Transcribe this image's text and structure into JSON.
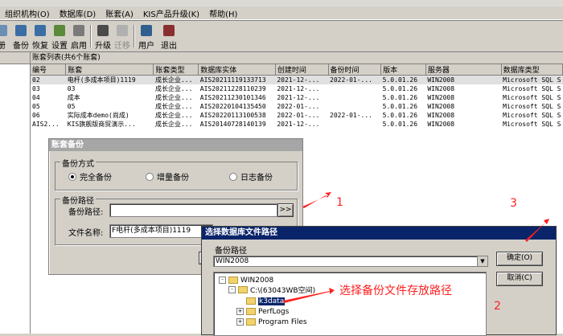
{
  "menu": [
    "组织机构(O)",
    "数据库(D)",
    "账套(A)",
    "KIS产品升级(K)",
    "帮助(H)"
  ],
  "toolbar": [
    {
      "label": "备份",
      "icon": "backup-icon",
      "color": "#3a6ea5"
    },
    {
      "label": "恢复",
      "icon": "restore-icon",
      "color": "#3a6ea5"
    },
    {
      "label": "设置",
      "icon": "settings-icon",
      "color": "#5a8a3a"
    },
    {
      "label": "启用",
      "icon": "enable-icon",
      "color": "#7a7a7a"
    },
    {
      "label": "升级",
      "icon": "upgrade-icon",
      "color": "#4a4a4a"
    },
    {
      "label": "迁移",
      "icon": "migrate-icon",
      "color": "#a0a0a0"
    },
    {
      "label": "用户",
      "icon": "user-icon",
      "color": "#2f5f8f"
    },
    {
      "label": "退出",
      "icon": "exit-icon",
      "color": "#8a2f2f"
    }
  ],
  "toolbar_left_partial": "册",
  "list_title": "账套列表(共6个账套)",
  "columns": [
    "编号",
    "账套",
    "账套类型",
    "数据库实体",
    "创建时间",
    "备份时间",
    "版本",
    "服务器",
    "数据库类型"
  ],
  "rows": [
    [
      "02",
      "电杆(多成本项目)1119",
      "成长企业...",
      "AIS20211119133713",
      "2021-12-...",
      "2022-01-...",
      "5.0.01.26",
      "WIN2008",
      "Microsoft SQL S"
    ],
    [
      "03",
      "03",
      "成长企业...",
      "AIS20211228110239",
      "2021-12-...",
      "",
      "5.0.01.26",
      "WIN2008",
      "Microsoft SQL S"
    ],
    [
      "04",
      "成本",
      "成长企业...",
      "AIS20211230101346",
      "2021-12-...",
      "",
      "5.0.01.26",
      "WIN2008",
      "Microsoft SQL S"
    ],
    [
      "05",
      "05",
      "成长企业...",
      "AIS20220104135450",
      "2022-01-...",
      "",
      "5.0.01.26",
      "WIN2008",
      "Microsoft SQL S"
    ],
    [
      "06",
      "实际成本demo(尚成)",
      "成长企业...",
      "AIS20220113100538",
      "2022-01-...",
      "2022-01-...",
      "5.0.01.26",
      "WIN2008",
      "Microsoft SQL S"
    ],
    [
      "AIS2...",
      "KIS旗舰版商贸演示...",
      "成长企业...",
      "AIS20140728140139",
      "2021-12-...",
      "",
      "5.0.01.26",
      "WIN2008",
      "Microsoft SQL S"
    ]
  ],
  "backup_dialog": {
    "title": "账套备份",
    "mode_group": "备份方式",
    "modes": [
      "完全备份",
      "增量备份",
      "日志备份"
    ],
    "path_group": "备份路径",
    "path_label": "备份路径:",
    "path_value": "",
    "browse_label": ">>",
    "file_label": "文件名称:",
    "file_value": "F电杆(多成本项目)1119"
  },
  "select_dialog": {
    "title": "选择数据库文件路径",
    "group": "备份路径",
    "server": "WIN2008",
    "ok": "确定(O)",
    "cancel": "取消(C)",
    "tree": [
      {
        "label": "WIN2008",
        "expand": "-"
      },
      {
        "label": "C:\\(63043WB空间)",
        "expand": "-"
      },
      {
        "label": "k3data",
        "expand": ""
      },
      {
        "label": "PerfLogs",
        "expand": "+"
      },
      {
        "label": "Program Files",
        "expand": "+"
      }
    ]
  },
  "annotations": {
    "n1": "1",
    "n2": "2",
    "n3": "3",
    "hint": "选择备份文件存放路径",
    "color": "#ff2020"
  }
}
